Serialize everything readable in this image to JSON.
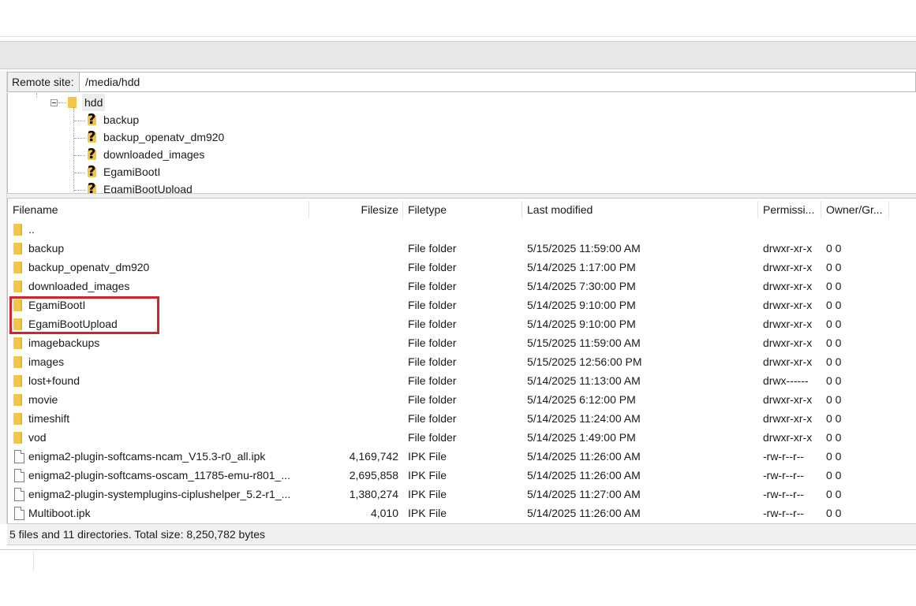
{
  "remote_site": {
    "label": "Remote site:",
    "path": "/media/hdd"
  },
  "tree": {
    "root": "hdd",
    "children": [
      "backup",
      "backup_openatv_dm920",
      "downloaded_images",
      "EgamiBootI",
      "EgamiBootUpload"
    ]
  },
  "columns": {
    "filename": "Filename",
    "filesize": "Filesize",
    "filetype": "Filetype",
    "last_modified": "Last modified",
    "permissions": "Permissi...",
    "owner": "Owner/Gr..."
  },
  "files": [
    {
      "name": "..",
      "size": "",
      "type": "",
      "modified": "",
      "perm": "",
      "owner": "",
      "icon": "folder-icon"
    },
    {
      "name": "backup",
      "size": "",
      "type": "File folder",
      "modified": "5/15/2025 11:59:00 AM",
      "perm": "drwxr-xr-x",
      "owner": "0 0",
      "icon": "folder-icon"
    },
    {
      "name": "backup_openatv_dm920",
      "size": "",
      "type": "File folder",
      "modified": "5/14/2025 1:17:00 PM",
      "perm": "drwxr-xr-x",
      "owner": "0 0",
      "icon": "folder-icon"
    },
    {
      "name": "downloaded_images",
      "size": "",
      "type": "File folder",
      "modified": "5/14/2025 7:30:00 PM",
      "perm": "drwxr-xr-x",
      "owner": "0 0",
      "icon": "folder-icon"
    },
    {
      "name": "EgamiBootI",
      "size": "",
      "type": "File folder",
      "modified": "5/14/2025 9:10:00 PM",
      "perm": "drwxr-xr-x",
      "owner": "0 0",
      "icon": "folder-icon"
    },
    {
      "name": "EgamiBootUpload",
      "size": "",
      "type": "File folder",
      "modified": "5/14/2025 9:10:00 PM",
      "perm": "drwxr-xr-x",
      "owner": "0 0",
      "icon": "folder-icon"
    },
    {
      "name": "imagebackups",
      "size": "",
      "type": "File folder",
      "modified": "5/15/2025 11:59:00 AM",
      "perm": "drwxr-xr-x",
      "owner": "0 0",
      "icon": "folder-icon"
    },
    {
      "name": "images",
      "size": "",
      "type": "File folder",
      "modified": "5/15/2025 12:56:00 PM",
      "perm": "drwxr-xr-x",
      "owner": "0 0",
      "icon": "folder-icon"
    },
    {
      "name": "lost+found",
      "size": "",
      "type": "File folder",
      "modified": "5/14/2025 11:13:00 AM",
      "perm": "drwx------",
      "owner": "0 0",
      "icon": "folder-icon"
    },
    {
      "name": "movie",
      "size": "",
      "type": "File folder",
      "modified": "5/14/2025 6:12:00 PM",
      "perm": "drwxr-xr-x",
      "owner": "0 0",
      "icon": "folder-icon"
    },
    {
      "name": "timeshift",
      "size": "",
      "type": "File folder",
      "modified": "5/14/2025 11:24:00 AM",
      "perm": "drwxr-xr-x",
      "owner": "0 0",
      "icon": "folder-icon"
    },
    {
      "name": "vod",
      "size": "",
      "type": "File folder",
      "modified": "5/14/2025 1:49:00 PM",
      "perm": "drwxr-xr-x",
      "owner": "0 0",
      "icon": "folder-icon"
    },
    {
      "name": "enigma2-plugin-softcams-ncam_V15.3-r0_all.ipk",
      "size": "4,169,742",
      "type": "IPK File",
      "modified": "5/14/2025 11:26:00 AM",
      "perm": "-rw-r--r--",
      "owner": "0 0",
      "icon": "file-icon"
    },
    {
      "name": "enigma2-plugin-softcams-oscam_11785-emu-r801_...",
      "size": "2,695,858",
      "type": "IPK File",
      "modified": "5/14/2025 11:26:00 AM",
      "perm": "-rw-r--r--",
      "owner": "0 0",
      "icon": "file-icon"
    },
    {
      "name": "enigma2-plugin-systemplugins-ciplushelper_5.2-r1_...",
      "size": "1,380,274",
      "type": "IPK File",
      "modified": "5/14/2025 11:27:00 AM",
      "perm": "-rw-r--r--",
      "owner": "0 0",
      "icon": "file-icon"
    },
    {
      "name": "Multiboot.ipk",
      "size": "4,010",
      "type": "IPK File",
      "modified": "5/14/2025 11:26:00 AM",
      "perm": "-rw-r--r--",
      "owner": "0 0",
      "icon": "file-icon"
    }
  ],
  "status": "5 files and 11 directories. Total size: 8,250,782 bytes",
  "highlight_color": "#d6232a"
}
